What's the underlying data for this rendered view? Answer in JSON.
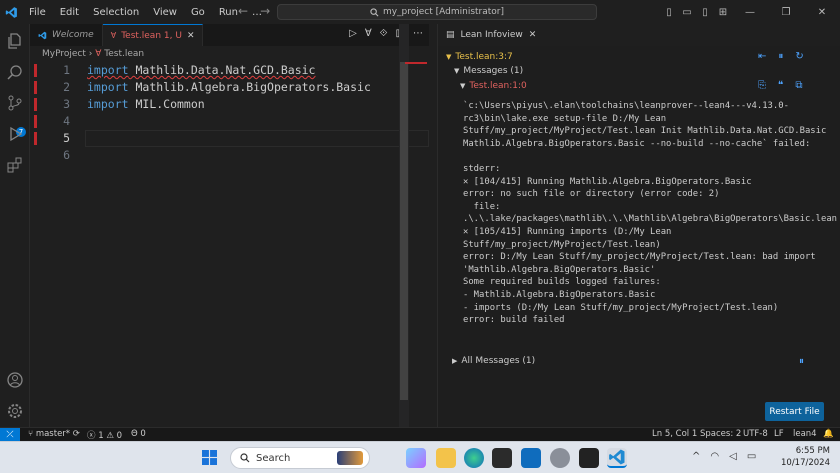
{
  "titlebar": {
    "menu": [
      "File",
      "Edit",
      "Selection",
      "View",
      "Go",
      "Run"
    ],
    "more": "…",
    "search_text": "my_project [Administrator]",
    "nav_back": "←",
    "nav_fwd": "→"
  },
  "activity": {
    "scm_badge": "7"
  },
  "tabs": [
    {
      "label": "Welcome"
    },
    {
      "label": "Test.lean 1, U"
    }
  ],
  "breadcrumb": {
    "folder": "MyProject",
    "sep": "›",
    "file": "Test.lean"
  },
  "code": {
    "lines": [
      {
        "n": "1",
        "kw": "import",
        "rest": " Mathlib.Data.Nat.GCD.Basic"
      },
      {
        "n": "2",
        "kw": "import",
        "rest": " Mathlib.Algebra.BigOperators.Basic"
      },
      {
        "n": "3",
        "kw": "import",
        "rest": " MIL.Common"
      },
      {
        "n": "4",
        "kw": "",
        "rest": ""
      },
      {
        "n": "5",
        "kw": "",
        "rest": ""
      },
      {
        "n": "6",
        "kw": "",
        "rest": ""
      }
    ]
  },
  "panel": {
    "tab": "Lean Infoview",
    "location": "Test.lean:3:7",
    "messages_header": "Messages (1)",
    "message_loc": "Test.lean:1:0",
    "message": "`c:\\Users\\piyus\\.elan\\toolchains\\leanprover--lean4---v4.13.0-\nrc3\\bin\\lake.exe setup-file D:/My Lean\nStuff/my_project/MyProject/Test.lean Init Mathlib.Data.Nat.GCD.Basic\nMathlib.Algebra.BigOperators.Basic --no-build --no-cache` failed:\n\nstderr:\n✕ [104/415] Running Mathlib.Algebra.BigOperators.Basic\nerror: no such file or directory (error code: 2)\n  file:\n.\\.\\.lake/packages\\mathlib\\.\\.\\Mathlib\\Algebra\\BigOperators\\Basic.lean\n✕ [105/415] Running imports (D:/My Lean\nStuff/my_project/MyProject/Test.lean)\nerror: D:/My Lean Stuff/my_project/MyProject/Test.lean: bad import\n'Mathlib.Algebra.BigOperators.Basic'\nSome required builds logged failures:\n- Mathlib.Algebra.BigOperators.Basic\n- imports (D:/My Lean Stuff/my_project/MyProject/Test.lean)\nerror: build failed",
    "all_messages": "All Messages (1)",
    "restart": "Restart File"
  },
  "status": {
    "branch": "master*",
    "errors": "ⓧ 1",
    "warnings": "⚠ 0",
    "ports": "Θ 0",
    "position": "Ln 5, Col 1",
    "spaces": "Spaces: 2",
    "encoding": "UTF-8",
    "eol": "LF",
    "lang": "lean4"
  },
  "taskbar": {
    "search": "Search",
    "time": "6:55 PM",
    "date": "10/17/2024"
  },
  "colors": {
    "accent": "#0078d4",
    "error": "#e0625f",
    "keyword": "#569cd6",
    "warning_loc": "#e8c04a"
  }
}
